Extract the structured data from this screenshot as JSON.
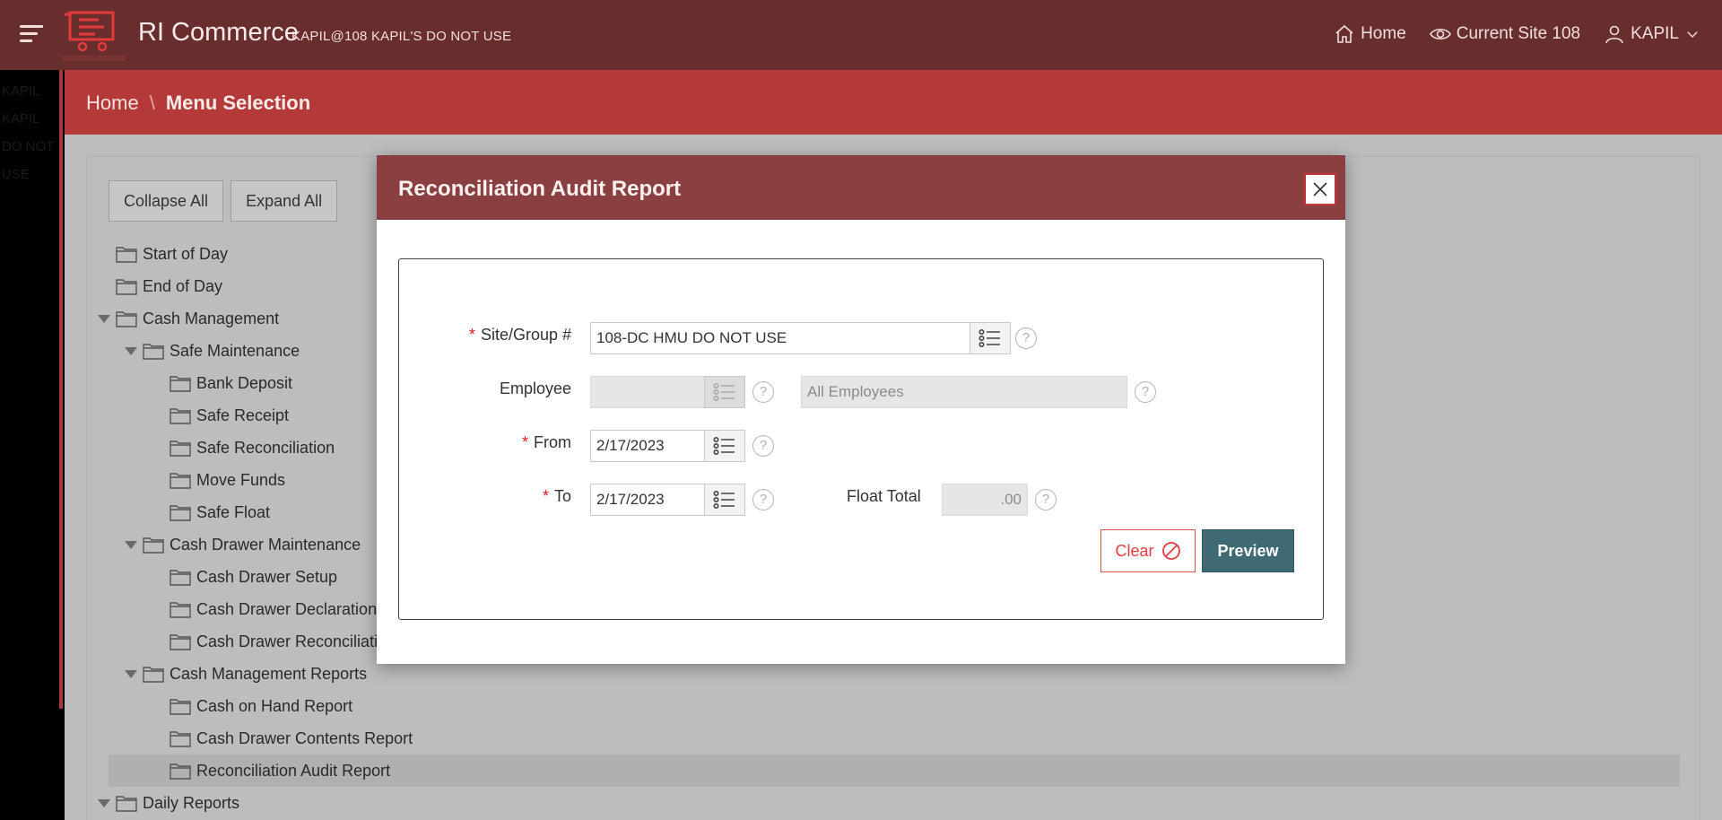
{
  "header": {
    "app_title": "RI Commerce",
    "subtitle": "KAPIL@108 KAPIL'S DO NOT USE",
    "nav": {
      "home": "Home",
      "current_site": "Current Site 108",
      "user": "KAPIL"
    }
  },
  "left_strip": {
    "text": "KAPIL KAPIL DO NOT USE"
  },
  "breadcrumb": {
    "home": "Home",
    "separator": "\\",
    "current": "Menu Selection"
  },
  "tree_buttons": {
    "collapse_all": "Collapse All",
    "expand_all": "Expand All"
  },
  "tree": [
    {
      "label": "Start of Day",
      "level": 1,
      "open": false
    },
    {
      "label": "End of Day",
      "level": 1,
      "open": false
    },
    {
      "label": "Cash Management",
      "level": 1,
      "open": true
    },
    {
      "label": "Safe Maintenance",
      "level": 2,
      "open": true
    },
    {
      "label": "Bank Deposit",
      "level": 3,
      "open": false
    },
    {
      "label": "Safe Receipt",
      "level": 3,
      "open": false
    },
    {
      "label": "Safe Reconciliation",
      "level": 3,
      "open": false
    },
    {
      "label": "Move Funds",
      "level": 3,
      "open": false
    },
    {
      "label": "Safe Float",
      "level": 3,
      "open": false
    },
    {
      "label": "Cash Drawer Maintenance",
      "level": 2,
      "open": true
    },
    {
      "label": "Cash Drawer Setup",
      "level": 3,
      "open": false
    },
    {
      "label": "Cash Drawer Declaration",
      "level": 3,
      "open": false
    },
    {
      "label": "Cash Drawer Reconciliation",
      "level": 3,
      "open": false
    },
    {
      "label": "Cash Management Reports",
      "level": 2,
      "open": true
    },
    {
      "label": "Cash on Hand Report",
      "level": 3,
      "open": false
    },
    {
      "label": "Cash Drawer Contents Report",
      "level": 3,
      "open": false
    },
    {
      "label": "Reconciliation Audit Report",
      "level": 3,
      "open": false,
      "selected": true
    },
    {
      "label": "Daily Reports",
      "level": 1,
      "open": true
    }
  ],
  "modal": {
    "title": "Reconciliation Audit Report",
    "fields": {
      "site_label": "Site/Group #",
      "site_value": "108-DC HMU DO NOT USE",
      "employee_label": "Employee",
      "employee_value": "",
      "employee_name": "All Employees",
      "from_label": "From",
      "from_value": "2/17/2023",
      "to_label": "To",
      "to_value": "2/17/2023",
      "float_total_label": "Float Total",
      "float_total_value": ".00"
    },
    "required_mark": "*",
    "help_glyph": "?",
    "buttons": {
      "clear": "Clear",
      "preview": "Preview"
    }
  },
  "colors": {
    "header_bg": "#682d2d",
    "breadcrumb_bg": "#b43a3a",
    "modal_header_bg": "#8a3f40",
    "preview_bg": "#3e6a73",
    "required": "#dd2222"
  },
  "icons": [
    "menu-icon",
    "home-icon",
    "eye-icon",
    "user-icon",
    "chevron-down-icon",
    "folder-icon",
    "close-icon",
    "list-icon",
    "help-icon",
    "clear-icon"
  ]
}
